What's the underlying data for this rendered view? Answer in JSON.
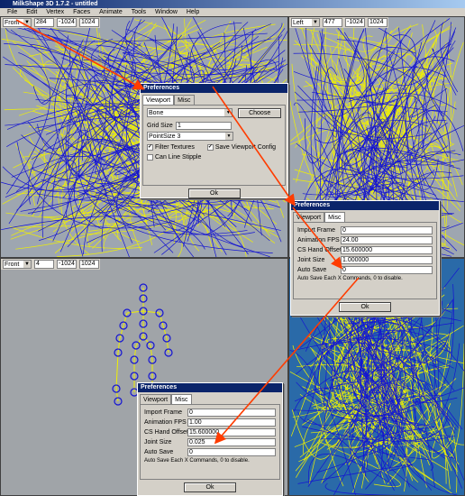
{
  "app": {
    "title": "MilkShape 3D 1.7.2 - untitled"
  },
  "menu": [
    "File",
    "Edit",
    "Vertex",
    "Faces",
    "Animate",
    "Tools",
    "Window",
    "Help"
  ],
  "viewports": {
    "front_top": {
      "view": "Front",
      "f1": "284",
      "f2": "-1024",
      "f3": "1024"
    },
    "left_top": {
      "view": "Left",
      "f1": "477",
      "f2": "-1024",
      "f3": "1024"
    },
    "front_bottom": {
      "view": "Front",
      "f1": "4",
      "f2": "-1024",
      "f3": "1024"
    }
  },
  "dialog1": {
    "title": "Preferences",
    "tabs": [
      "Viewport",
      "Misc"
    ],
    "object_type": "Bone",
    "choose_label": "Choose",
    "grid_size_label": "Grid Size",
    "grid_size_value": "1",
    "point_size": "PointSize 3",
    "filter_textures": "Filter Textures",
    "save_viewport_config": "Save Viewport Config",
    "line_stipple": "Can Line Stipple",
    "ok_label": "Ok"
  },
  "dialog2": {
    "title": "Preferences",
    "tabs": [
      "Viewport",
      "Misc"
    ],
    "fields": [
      {
        "label": "Import Frame",
        "value": "0"
      },
      {
        "label": "Animation FPS",
        "value": "24.00"
      },
      {
        "label": "CS Hand Offset",
        "value": "15.600000"
      },
      {
        "label": "Joint Size",
        "value": "1.000000"
      },
      {
        "label": "Auto Save",
        "value": "0"
      }
    ],
    "note": "Auto Save Each X Commands, 0 to disable.",
    "ok_label": "Ok"
  },
  "dialog3": {
    "title": "Preferences",
    "tabs": [
      "Viewport",
      "Misc"
    ],
    "fields": [
      {
        "label": "Import Frame",
        "value": "0"
      },
      {
        "label": "Animation FPS",
        "value": "1.00"
      },
      {
        "label": "CS Hand Offset",
        "value": "15.600000"
      },
      {
        "label": "Joint Size",
        "value": "0.025"
      },
      {
        "label": "Auto Save",
        "value": "0"
      }
    ],
    "note": "Auto Save Each X Commands, 0 to disable.",
    "ok_label": "Ok"
  },
  "colors": {
    "wire_blue": "#1414d2",
    "wire_yellow": "#f0f000",
    "arrow": "#ff3c00",
    "viewport_bg": "#9ea6b0",
    "persp_bg": "#2a6aa8"
  }
}
